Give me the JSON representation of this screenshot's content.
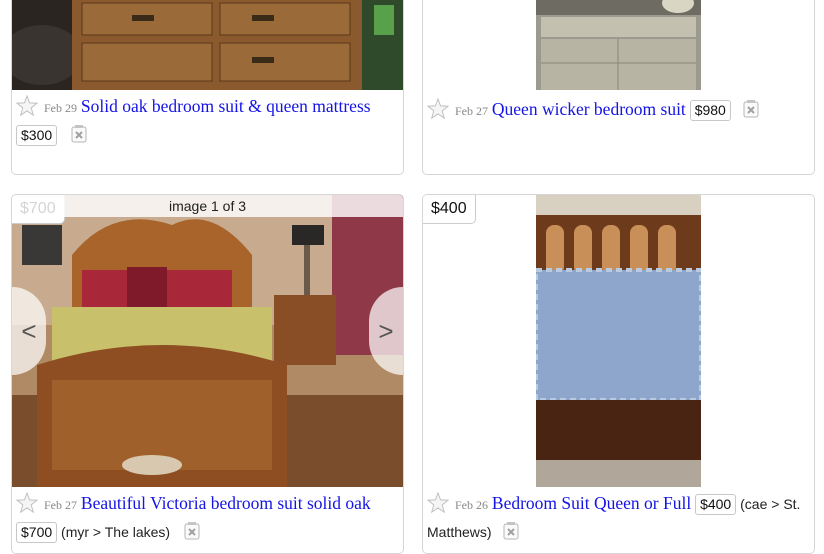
{
  "listings": [
    {
      "date": "Feb 29",
      "title": "Solid oak bedroom suit & queen mattress",
      "price": "$300",
      "hood": ""
    },
    {
      "date": "Feb 27",
      "title": "Queen wicker bedroom suit",
      "price": "$980",
      "hood": ""
    },
    {
      "date": "Feb 27",
      "title": "Beautiful Victoria bedroom suit solid oak",
      "price": "$700",
      "photo_price": "$700",
      "image_count": "image 1 of 3",
      "prev_label": "<",
      "next_label": ">",
      "hood": "(myr > The lakes)"
    },
    {
      "date": "Feb 26",
      "title": "Bedroom Suit Queen or Full",
      "price": "$400",
      "photo_price": "$400",
      "hood_line1": "(cae > St.",
      "hood_line2": "Matthews)"
    }
  ],
  "icons": {
    "favorite": "star-icon",
    "hide": "hide-x-icon"
  },
  "colors": {
    "title_link": "#1414e6",
    "date": "#888888",
    "border": "#d6d6d6"
  }
}
